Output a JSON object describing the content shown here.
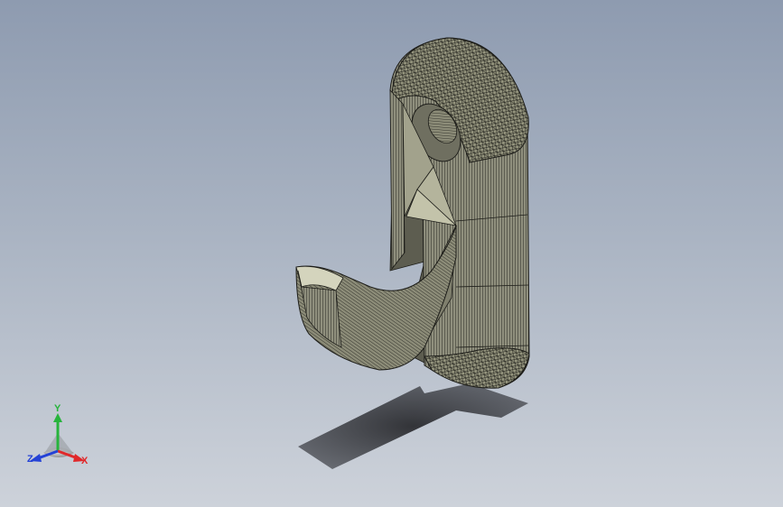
{
  "viewport": {
    "model_name": "hook",
    "display_style": "shaded-with-edges",
    "background_top": "#8e9bb0",
    "background_bottom": "#cdd2da"
  },
  "model": {
    "body_color": "#8f8f7d",
    "edge_color": "#1d1d19",
    "shadow_color": "#2e2f33"
  },
  "triad": {
    "x_label": "X",
    "y_label": "Y",
    "z_label": "Z",
    "x_color": "#e0282a",
    "y_color": "#27b43c",
    "z_color": "#2442d6"
  }
}
